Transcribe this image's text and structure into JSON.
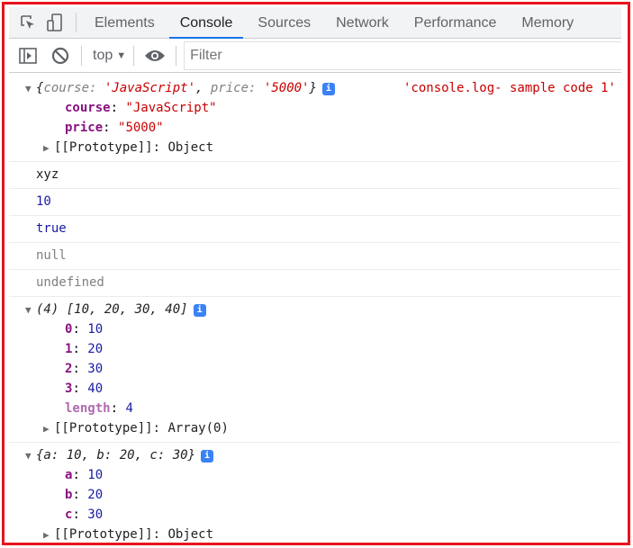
{
  "tabs": [
    "Elements",
    "Console",
    "Sources",
    "Network",
    "Performance",
    "Memory"
  ],
  "toolbar": {
    "context": "top",
    "filter_placeholder": "Filter"
  },
  "messages": {
    "obj1": {
      "preview_open": "{",
      "k1": "course",
      "v1": "'JavaScript'",
      "k2": "price",
      "v2": "'5000'",
      "preview_close": "}",
      "source": "'console.log- sample code 1'",
      "props": [
        {
          "key": "course",
          "value": "\"JavaScript\""
        },
        {
          "key": "price",
          "value": "\"5000\""
        }
      ],
      "proto": "[[Prototype]]",
      "proto_val": "Object"
    },
    "s1": "xyz",
    "n1": "10",
    "b1": "true",
    "null": "null",
    "undef": "undefined",
    "arr": {
      "preview": "(4) [10, 20, 30, 40]",
      "props": [
        {
          "key": "0",
          "value": "10"
        },
        {
          "key": "1",
          "value": "20"
        },
        {
          "key": "2",
          "value": "30"
        },
        {
          "key": "3",
          "value": "40"
        }
      ],
      "length_key": "length",
      "length_val": "4",
      "proto": "[[Prototype]]",
      "proto_val": "Array(0)"
    },
    "obj2": {
      "preview": "{a: 10, b: 20, c: 30}",
      "props": [
        {
          "key": "a",
          "value": "10"
        },
        {
          "key": "b",
          "value": "20"
        },
        {
          "key": "c",
          "value": "30"
        }
      ],
      "proto": "[[Prototype]]",
      "proto_val": "Object"
    }
  },
  "info_icon": "i"
}
